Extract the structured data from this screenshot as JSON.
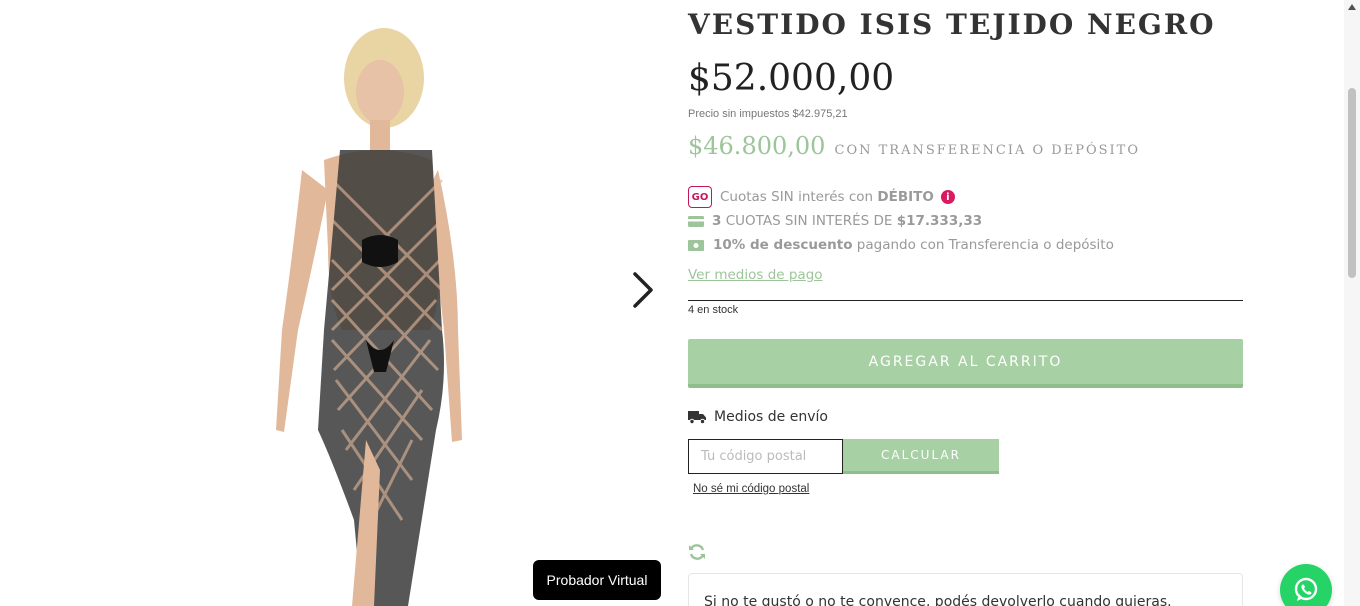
{
  "product": {
    "title": "VESTIDO ISIS TEJIDO NEGRO",
    "price": "$52.000,00",
    "price_no_tax": "Precio sin impuestos $42.975,21",
    "promo_price": "$46.800,00",
    "promo_label": "CON TRANSFERENCIA O DEPÓSITO",
    "stock": "4 en stock"
  },
  "payments": {
    "go_badge": "GO",
    "debit_text": "Cuotas SIN interés con",
    "debit_bold": "DÉBITO",
    "info_glyph": "i",
    "installments_bold": "3",
    "installments_text": "CUOTAS SIN INTERÉS DE",
    "installments_amount": "$17.333,33",
    "discount_bold": "10% de descuento",
    "discount_text": "pagando con Transferencia o depósito",
    "link": "Ver medios de pago"
  },
  "cart": {
    "button_label": "AGREGAR AL CARRITO"
  },
  "shipping": {
    "label": "Medios de envío",
    "postal_placeholder": "Tu código postal",
    "calc_button": "CALCULAR",
    "unknown_link": "No sé mi código postal"
  },
  "returns": {
    "text": "Si no te gustó o no te convence, podés devolverlo cuando quieras."
  },
  "gallery": {
    "virtual_fitting_button": "Probador Virtual"
  },
  "colors": {
    "accent_green": "#a8d0a5",
    "promo_green": "#9dc59a",
    "go_magenta": "#c2185b",
    "whatsapp_green": "#25d366"
  },
  "icons": [
    "go-badge-icon",
    "info-icon",
    "credit-card-icon",
    "cash-icon",
    "truck-icon",
    "refresh-icon",
    "chevron-right-icon",
    "whatsapp-icon"
  ]
}
